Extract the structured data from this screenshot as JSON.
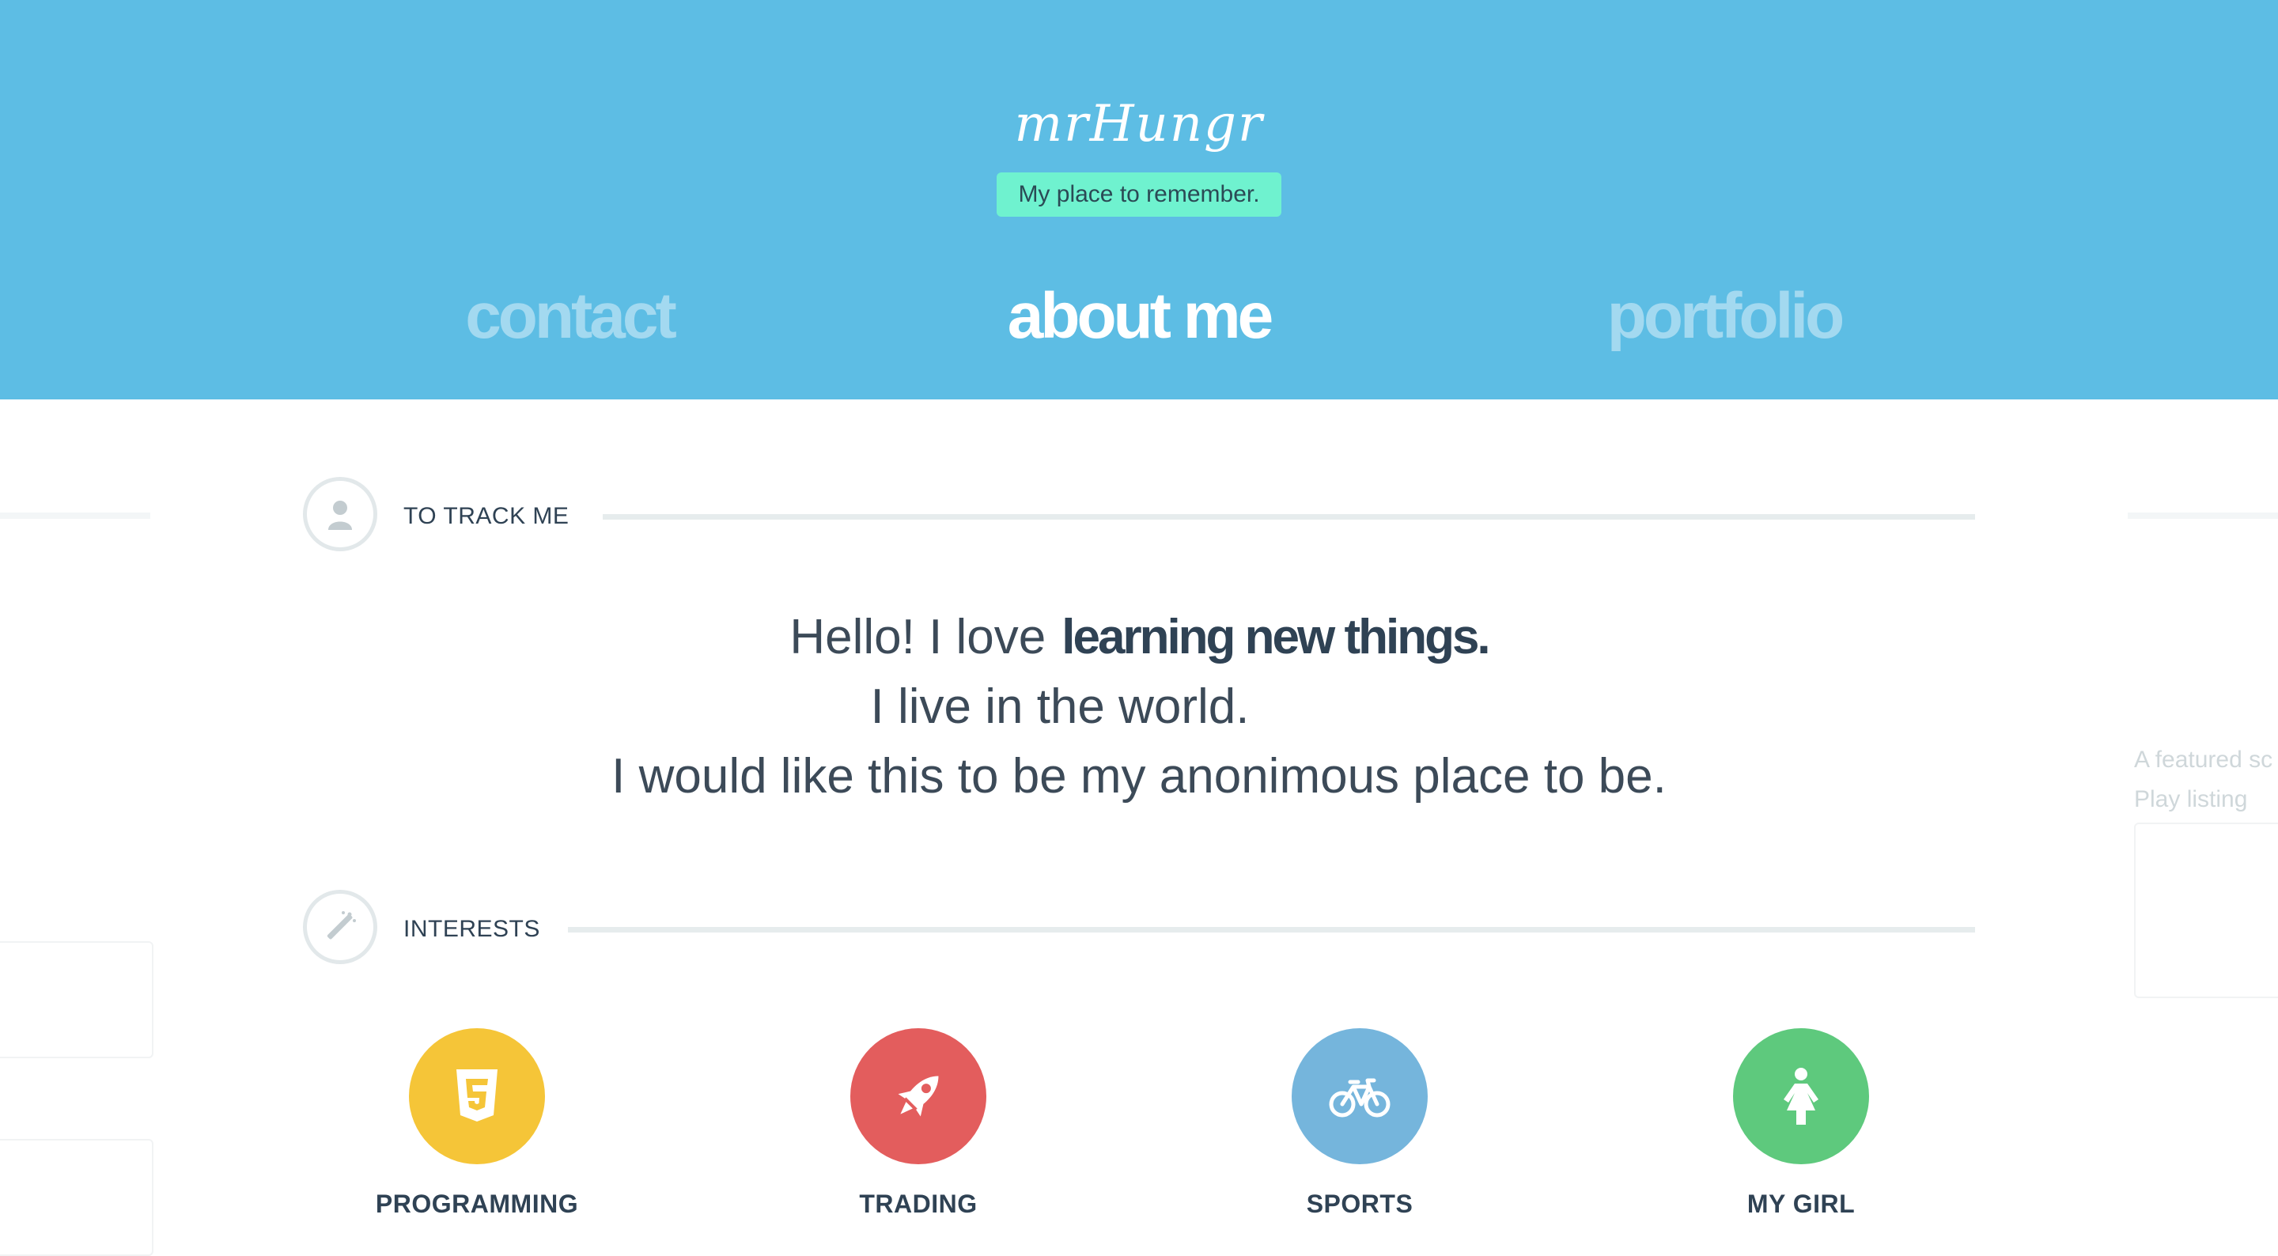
{
  "header": {
    "site_title": "mrHungr",
    "tagline": "My place to remember."
  },
  "nav": {
    "contact": "contact",
    "about": "about me",
    "portfolio": "portfolio",
    "active": "about me"
  },
  "sections": {
    "track": {
      "label": "TO TRACK ME",
      "icon": "user-icon"
    },
    "interests": {
      "label": "INTERESTS",
      "icon": "magic-wand-icon"
    }
  },
  "intro": {
    "line1_prefix": "Hello! I love",
    "line1_emphasis": "learning new things.",
    "line2": "I live in the world.",
    "line3": "I would like this to be my anonimous place to be."
  },
  "interests": [
    {
      "label": "PROGRAMMING",
      "icon": "html5-icon",
      "color": "#f5c538"
    },
    {
      "label": "TRADING",
      "icon": "rocket-icon",
      "color": "#e35d5d"
    },
    {
      "label": "SPORTS",
      "icon": "bicycle-icon",
      "color": "#75b5dc"
    },
    {
      "label": "MY GIRL",
      "icon": "woman-icon",
      "color": "#5ec97d"
    }
  ],
  "sidebar_right": {
    "line1": "A featured sc",
    "line2": "Play listing"
  },
  "colors": {
    "header_bg": "#5dbde4",
    "tagline_bg": "#6ff2cf",
    "nav_inactive": "#a3d9f0",
    "text_dark": "#2f4254"
  }
}
